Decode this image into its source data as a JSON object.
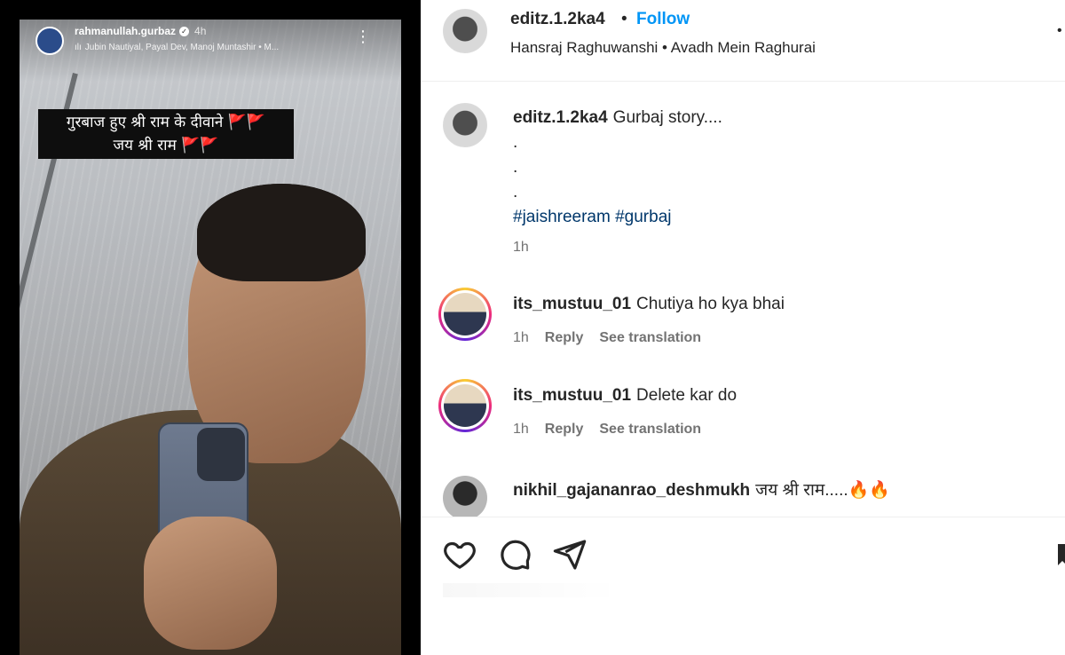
{
  "story": {
    "username": "rahmanullah.gurbaz",
    "time": "4h",
    "music": "Jubin Nautiyal, Payal Dev, Manoj Muntashir • M...",
    "overlay_line1": "गुरबाज हुए श्री राम के दीवाने",
    "overlay_line2": "जय श्री राम",
    "flags": "🚩🚩"
  },
  "post": {
    "username": "editz.1.2ka4",
    "separator": "•",
    "follow_label": "Follow",
    "audio": "Hansraj Raghuwanshi • Avadh Mein Raghurai",
    "more": "•"
  },
  "caption": {
    "username": "editz.1.2ka4",
    "text": "Gurbaj story....",
    "dots": [
      ".",
      ".",
      "."
    ],
    "hashtags": "#jaishreeram #gurbaj",
    "time": "1h"
  },
  "comments": [
    {
      "username": "its_mustuu_01",
      "text": "Chutiya ho kya bhai",
      "time": "1h",
      "reply": "Reply",
      "translate": "See translation"
    },
    {
      "username": "its_mustuu_01",
      "text": "Delete kar do",
      "time": "1h",
      "reply": "Reply",
      "translate": "See translation"
    },
    {
      "username": "nikhil_gajananrao_deshmukh",
      "text": "जय श्री राम.....🔥🔥"
    }
  ],
  "icons": {
    "like": "heart-icon",
    "comment": "comment-bubble-icon",
    "share": "paper-plane-icon",
    "save": "bookmark-icon"
  },
  "colors": {
    "follow": "#0095f6",
    "hashtag": "#00376b",
    "muted": "#737373"
  }
}
